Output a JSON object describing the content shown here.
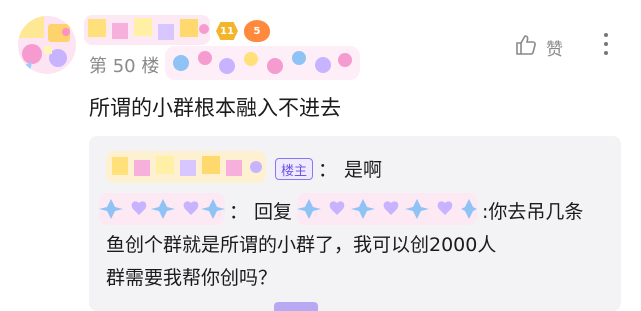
{
  "post": {
    "level_badge": "11",
    "flame_badge": "5",
    "floor_label": "第 50 楼",
    "like_label": "赞",
    "content": "所谓的小群根本融入不进去"
  },
  "replies": {
    "reply1": {
      "owner_tag": "楼主",
      "colon": "：",
      "text": "是啊"
    },
    "reply2": {
      "reply_prefix": "：  回复",
      "inline_text": ":你去吊几条",
      "line2": "鱼创个群就是所谓的小群了，我可以创2000人",
      "line3": "群需要我帮你创吗？"
    }
  },
  "colors": {
    "accent": "#7b63e8",
    "badge_gold": "#f3b52b",
    "badge_orange": "#ff8a3d",
    "pink": "#f6a0d2",
    "lavender": "#b59cf4",
    "yellow": "#ffe07a",
    "blue": "#8fc2f5"
  }
}
